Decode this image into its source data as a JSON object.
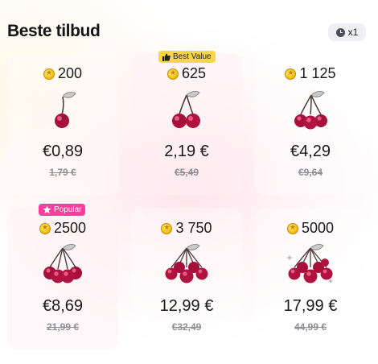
{
  "header": {
    "title": "Beste tilbud",
    "multiplier": "x1",
    "multiplier_icon": "clock-icon"
  },
  "offers": [
    {
      "coins": "200",
      "price": "€0,89",
      "old_price": "1,79 €",
      "badge": "",
      "cherries": 1
    },
    {
      "coins": "625",
      "price": "2,19 €",
      "old_price": "€5,49",
      "badge": "Best Value",
      "badge_icon": "thumbs-up-icon",
      "cherries": 2
    },
    {
      "coins": "1 125",
      "price": "€4,29",
      "old_price": "€9,64",
      "badge": "",
      "cherries": 3
    },
    {
      "coins": "2500",
      "price": "€8,69",
      "old_price": "21,99 €",
      "badge": "Popular",
      "badge_icon": "star-icon",
      "cherries": 4
    },
    {
      "coins": "3 750",
      "price": "12,99 €",
      "old_price": "€32,49",
      "badge": "",
      "cherries": 5
    },
    {
      "coins": "5000",
      "price": "17,99 €",
      "old_price": "44,99 €",
      "badge": "",
      "cherries": 6
    }
  ],
  "colors": {
    "best_value_badge": "#f6d54a",
    "popular_badge": "#ff3d9a",
    "cherry": "#b0133f",
    "coin": "#f5c518"
  }
}
